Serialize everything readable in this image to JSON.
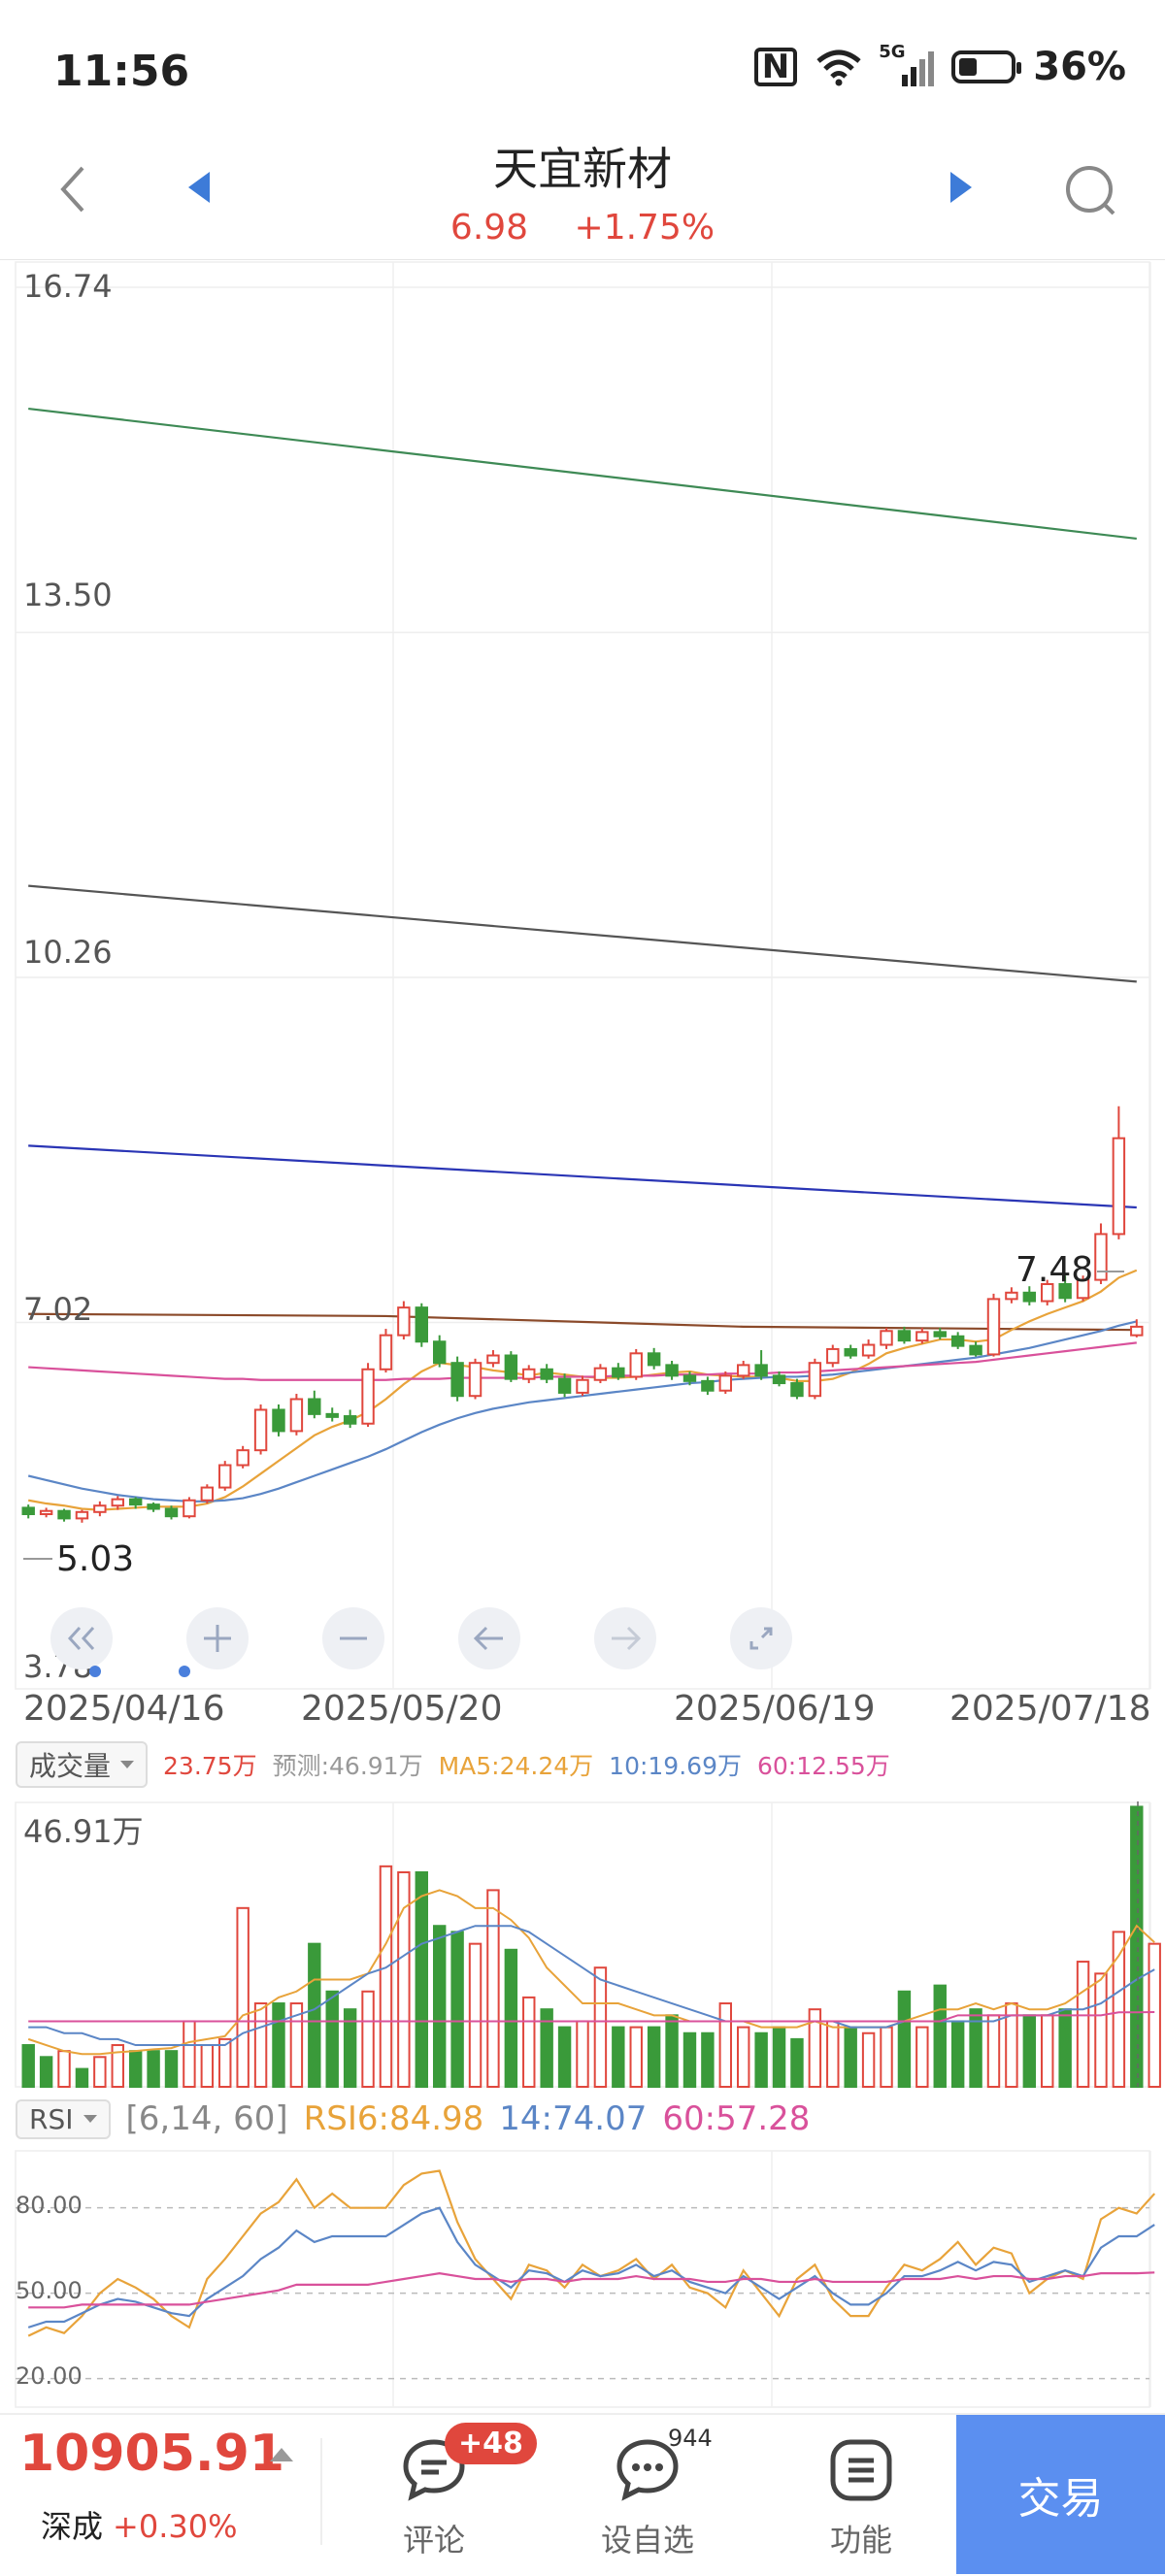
{
  "status_bar": {
    "time": "11:56",
    "network": "5G",
    "battery": "36%"
  },
  "header": {
    "title": "天宜新材",
    "price": "6.98",
    "change_pct": "+1.75%"
  },
  "chart_labels": {
    "y_ticks": [
      "16.74",
      "13.50",
      "10.26",
      "7.02",
      "3.78"
    ],
    "high_label": "7.48",
    "low_label": "5.03"
  },
  "dates": [
    "2025/04/16",
    "2025/05/20",
    "2025/06/19",
    "2025/07/18"
  ],
  "volume_legend": {
    "selector": "成交量",
    "current": "23.75万",
    "forecast": "预测:46.91万",
    "ma5": "MA5:24.24万",
    "ma10": "10:19.69万",
    "ma60": "60:12.55万",
    "max": "46.91万"
  },
  "rsi_legend": {
    "selector": "RSI",
    "params": "[6,14, 60]",
    "rsi6": "RSI6:84.98",
    "rsi14": "14:74.07",
    "rsi60": "60:57.28",
    "levels": [
      "80.00",
      "50.00",
      "20.00"
    ]
  },
  "bottom_bar": {
    "index_value": "10905.91",
    "index_name": "深成",
    "index_change": "+0.30%",
    "comment_label": "评论",
    "comment_badge": "+48",
    "fav_label": "设自选",
    "fav_count": "944",
    "func_label": "功能",
    "trade_label": "交易"
  },
  "colors": {
    "up": "#e0473d",
    "down": "#3a9a3a",
    "ma_orange": "#e8a33a",
    "ma_blue": "#5b86c6",
    "ma_pink": "#d9519b",
    "accent": "#5b8ff0"
  },
  "chart_data": {
    "type": "candlestick",
    "y_range": [
      3.78,
      16.74
    ],
    "dates": [
      "2025/04/16",
      "2025/05/20",
      "2025/06/19",
      "2025/07/18"
    ],
    "candles": [
      [
        5.28,
        5.22,
        5.31,
        5.18
      ],
      [
        5.22,
        5.25,
        5.28,
        5.19
      ],
      [
        5.25,
        5.18,
        5.27,
        5.15
      ],
      [
        5.18,
        5.24,
        5.26,
        5.14
      ],
      [
        5.24,
        5.3,
        5.34,
        5.2
      ],
      [
        5.3,
        5.36,
        5.39,
        5.26
      ],
      [
        5.36,
        5.31,
        5.38,
        5.27
      ],
      [
        5.31,
        5.27,
        5.33,
        5.24
      ],
      [
        5.27,
        5.2,
        5.3,
        5.17
      ],
      [
        5.2,
        5.35,
        5.38,
        5.18
      ],
      [
        5.35,
        5.47,
        5.5,
        5.32
      ],
      [
        5.47,
        5.68,
        5.72,
        5.44
      ],
      [
        5.68,
        5.82,
        5.86,
        5.65
      ],
      [
        5.82,
        6.2,
        6.25,
        5.78
      ],
      [
        6.2,
        6.0,
        6.25,
        5.95
      ],
      [
        6.0,
        6.3,
        6.35,
        5.96
      ],
      [
        6.3,
        6.16,
        6.38,
        6.12
      ],
      [
        6.16,
        6.14,
        6.22,
        6.09
      ],
      [
        6.14,
        6.07,
        6.2,
        6.03
      ],
      [
        6.07,
        6.58,
        6.64,
        6.04
      ],
      [
        6.58,
        6.9,
        6.96,
        6.55
      ],
      [
        6.9,
        7.16,
        7.22,
        6.86
      ],
      [
        7.16,
        6.84,
        7.2,
        6.79
      ],
      [
        6.84,
        6.64,
        6.9,
        6.6
      ],
      [
        6.64,
        6.33,
        6.7,
        6.28
      ],
      [
        6.33,
        6.64,
        6.68,
        6.3
      ],
      [
        6.64,
        6.71,
        6.76,
        6.6
      ],
      [
        6.71,
        6.49,
        6.75,
        6.46
      ],
      [
        6.49,
        6.58,
        6.62,
        6.45
      ],
      [
        6.58,
        6.49,
        6.63,
        6.45
      ],
      [
        6.49,
        6.36,
        6.54,
        6.32
      ],
      [
        6.36,
        6.48,
        6.52,
        6.33
      ],
      [
        6.48,
        6.59,
        6.63,
        6.45
      ],
      [
        6.59,
        6.51,
        6.64,
        6.48
      ],
      [
        6.51,
        6.73,
        6.77,
        6.48
      ],
      [
        6.73,
        6.62,
        6.78,
        6.58
      ],
      [
        6.62,
        6.52,
        6.66,
        6.48
      ],
      [
        6.52,
        6.47,
        6.56,
        6.43
      ],
      [
        6.47,
        6.38,
        6.51,
        6.34
      ],
      [
        6.38,
        6.52,
        6.56,
        6.35
      ],
      [
        6.52,
        6.62,
        6.66,
        6.49
      ],
      [
        6.62,
        6.52,
        6.76,
        6.48
      ],
      [
        6.52,
        6.45,
        6.56,
        6.42
      ],
      [
        6.45,
        6.33,
        6.49,
        6.3
      ],
      [
        6.33,
        6.64,
        6.68,
        6.3
      ],
      [
        6.64,
        6.77,
        6.81,
        6.6
      ],
      [
        6.77,
        6.71,
        6.81,
        6.68
      ],
      [
        6.71,
        6.81,
        6.86,
        6.68
      ],
      [
        6.81,
        6.94,
        6.97,
        6.77
      ],
      [
        6.94,
        6.85,
        6.98,
        6.82
      ],
      [
        6.85,
        6.93,
        6.97,
        6.82
      ],
      [
        6.93,
        6.89,
        6.97,
        6.86
      ],
      [
        6.89,
        6.8,
        6.93,
        6.77
      ],
      [
        6.8,
        6.72,
        6.84,
        6.7
      ],
      [
        6.72,
        7.24,
        7.29,
        6.7
      ],
      [
        7.24,
        7.3,
        7.35,
        7.2
      ],
      [
        7.3,
        7.22,
        7.36,
        7.18
      ],
      [
        7.22,
        7.38,
        7.42,
        7.18
      ],
      [
        7.38,
        7.25,
        7.46,
        7.21
      ],
      [
        7.25,
        7.42,
        7.46,
        7.22
      ],
      [
        7.42,
        7.85,
        7.95,
        7.38
      ],
      [
        7.85,
        8.75,
        9.05,
        7.8
      ],
      [
        6.9,
        6.98,
        7.05,
        6.88
      ]
    ],
    "trendlines": [
      {
        "color": "#3e8a55",
        "points": [
          [
            0,
            15.6
          ],
          [
            62,
            14.38
          ]
        ]
      },
      {
        "color": "#555555",
        "points": [
          [
            0,
            11.12
          ],
          [
            62,
            10.22
          ]
        ]
      },
      {
        "color": "#2a35b5",
        "points": [
          [
            0,
            8.68
          ],
          [
            62,
            8.1
          ]
        ]
      },
      {
        "color": "#8b4a2a",
        "points": [
          [
            0,
            7.1
          ],
          [
            20,
            7.08
          ],
          [
            40,
            6.98
          ],
          [
            62,
            6.95
          ]
        ]
      }
    ],
    "ma_lines": {
      "orange": [
        5.35,
        5.32,
        5.3,
        5.27,
        5.26,
        5.27,
        5.28,
        5.29,
        5.29,
        5.29,
        5.32,
        5.38,
        5.48,
        5.6,
        5.72,
        5.84,
        5.96,
        6.04,
        6.1,
        6.18,
        6.3,
        6.44,
        6.56,
        6.64,
        6.62,
        6.6,
        6.57,
        6.55,
        6.52,
        6.55,
        6.53,
        6.51,
        6.5,
        6.5,
        6.51,
        6.53,
        6.55,
        6.56,
        6.53,
        6.52,
        6.51,
        6.51,
        6.5,
        6.47,
        6.47,
        6.49,
        6.55,
        6.63,
        6.73,
        6.78,
        6.82,
        6.86,
        6.86,
        6.84,
        6.86,
        6.95,
        7.03,
        7.1,
        7.16,
        7.22,
        7.31,
        7.44,
        7.51
      ],
      "blue": [
        5.58,
        5.54,
        5.5,
        5.46,
        5.43,
        5.4,
        5.38,
        5.36,
        5.35,
        5.34,
        5.34,
        5.35,
        5.37,
        5.41,
        5.46,
        5.52,
        5.58,
        5.64,
        5.7,
        5.76,
        5.83,
        5.91,
        5.99,
        6.06,
        6.12,
        6.17,
        6.21,
        6.24,
        6.27,
        6.29,
        6.31,
        6.33,
        6.35,
        6.37,
        6.39,
        6.41,
        6.43,
        6.45,
        6.46,
        6.48,
        6.49,
        6.5,
        6.51,
        6.51,
        6.52,
        6.53,
        6.55,
        6.57,
        6.59,
        6.61,
        6.63,
        6.65,
        6.67,
        6.69,
        6.72,
        6.75,
        6.78,
        6.82,
        6.86,
        6.9,
        6.94,
        6.99,
        7.03
      ],
      "pink": [
        6.6,
        6.59,
        6.58,
        6.57,
        6.56,
        6.55,
        6.54,
        6.53,
        6.52,
        6.51,
        6.5,
        6.49,
        6.49,
        6.48,
        6.48,
        6.48,
        6.48,
        6.48,
        6.48,
        6.48,
        6.48,
        6.49,
        6.49,
        6.49,
        6.5,
        6.5,
        6.5,
        6.5,
        6.5,
        6.51,
        6.51,
        6.51,
        6.51,
        6.52,
        6.52,
        6.52,
        6.53,
        6.53,
        6.53,
        6.54,
        6.54,
        6.54,
        6.55,
        6.55,
        6.56,
        6.57,
        6.58,
        6.59,
        6.6,
        6.61,
        6.62,
        6.63,
        6.64,
        6.65,
        6.67,
        6.69,
        6.71,
        6.73,
        6.75,
        6.77,
        6.79,
        6.81,
        6.83
      ]
    },
    "volume_max": 46.91,
    "volume": [
      7,
      5,
      6,
      3,
      5,
      7,
      6,
      6,
      6,
      11,
      7,
      8,
      30,
      14,
      14,
      14,
      24,
      16,
      13,
      16,
      37,
      36,
      36,
      27,
      26,
      24,
      33,
      23,
      15,
      13,
      10,
      11,
      20,
      10,
      10,
      10,
      12,
      9,
      9,
      14,
      10,
      9,
      10,
      8,
      13,
      11,
      10,
      9,
      10,
      16,
      10,
      17,
      11,
      13,
      12,
      14,
      12,
      12,
      13,
      21,
      19,
      26,
      47,
      24
    ],
    "volume_up": [
      false,
      false,
      true,
      false,
      true,
      true,
      false,
      false,
      false,
      true,
      true,
      true,
      true,
      true,
      false,
      true,
      false,
      false,
      false,
      true,
      true,
      true,
      false,
      false,
      false,
      true,
      true,
      false,
      true,
      false,
      false,
      true,
      true,
      false,
      true,
      false,
      false,
      false,
      false,
      true,
      true,
      false,
      false,
      false,
      true,
      true,
      false,
      true,
      true,
      false,
      true,
      false,
      false,
      false,
      true,
      true,
      false,
      true,
      false,
      true,
      true,
      true,
      false,
      true
    ],
    "volume_ma": {
      "orange": [
        8,
        7,
        6,
        5.5,
        5.5,
        5.8,
        6,
        6.3,
        6.5,
        7.5,
        8,
        8.5,
        12,
        13,
        15,
        16,
        18,
        18,
        18,
        19,
        24,
        30,
        32,
        33,
        32,
        30,
        30,
        28,
        25,
        20,
        17,
        14,
        14,
        14,
        13,
        12,
        12,
        11,
        11,
        11,
        11,
        10,
        10,
        10,
        11,
        10,
        10,
        10,
        10,
        11,
        12,
        13,
        13,
        14,
        13,
        14,
        13,
        13,
        14,
        16,
        18,
        22,
        27,
        24.24
      ],
      "blue": [
        10,
        10,
        9,
        9,
        8,
        8,
        7,
        7,
        7,
        7,
        7,
        7,
        9,
        10,
        11,
        12,
        13,
        15,
        17,
        19,
        20,
        22,
        24,
        25,
        26,
        27,
        27,
        27,
        26,
        24,
        22,
        20,
        18,
        17,
        16,
        15,
        14,
        13,
        12,
        11,
        11,
        11,
        11,
        11,
        11,
        11,
        10,
        10,
        10,
        11,
        11,
        11,
        11,
        11,
        11,
        12,
        12,
        12,
        13,
        13,
        14,
        16,
        18,
        19.69
      ],
      "pink": [
        11,
        11,
        11,
        11,
        11,
        11,
        11,
        11,
        11,
        11,
        11,
        11,
        11,
        11,
        11,
        11,
        11,
        11,
        11,
        11,
        11,
        11,
        11,
        11,
        11,
        11,
        11,
        11,
        11,
        11,
        11,
        11,
        11,
        11,
        11,
        11,
        11,
        11,
        11,
        11,
        11,
        11,
        11,
        11,
        11,
        11,
        11,
        11,
        11,
        11,
        11,
        11,
        12,
        12,
        12,
        12,
        12,
        12,
        12,
        12,
        12,
        12.5,
        12.5,
        12.55
      ]
    },
    "rsi_range": [
      10,
      100
    ],
    "rsi": {
      "rsi6": [
        35,
        38,
        36,
        42,
        50,
        55,
        52,
        48,
        42,
        38,
        55,
        62,
        70,
        78,
        82,
        90,
        80,
        85,
        80,
        80,
        80,
        88,
        92,
        93,
        75,
        62,
        55,
        48,
        60,
        58,
        52,
        60,
        56,
        58,
        62,
        55,
        60,
        52,
        50,
        45,
        58,
        50,
        42,
        55,
        60,
        48,
        42,
        42,
        52,
        60,
        58,
        62,
        68,
        60,
        66,
        64,
        50,
        55,
        58,
        55,
        76,
        80,
        78,
        84.98
      ],
      "rsi14": [
        38,
        40,
        40,
        43,
        46,
        48,
        47,
        45,
        43,
        42,
        48,
        52,
        56,
        62,
        66,
        72,
        68,
        70,
        70,
        70,
        70,
        74,
        78,
        80,
        68,
        60,
        56,
        52,
        58,
        57,
        54,
        58,
        56,
        57,
        60,
        56,
        58,
        54,
        52,
        50,
        56,
        52,
        48,
        52,
        56,
        50,
        46,
        46,
        50,
        56,
        56,
        58,
        61,
        58,
        61,
        60,
        54,
        56,
        58,
        56,
        66,
        70,
        70,
        74.07
      ],
      "rsi60": [
        45,
        45,
        45,
        46,
        46,
        46,
        46,
        46,
        46,
        46,
        47,
        48,
        49,
        50,
        51,
        53,
        53,
        53,
        53,
        53,
        54,
        55,
        56,
        57,
        56,
        55,
        55,
        54,
        55,
        55,
        54,
        55,
        55,
        55,
        56,
        55,
        55,
        55,
        54,
        54,
        55,
        55,
        54,
        54,
        55,
        54,
        54,
        54,
        54,
        55,
        55,
        55,
        56,
        55,
        56,
        56,
        55,
        55,
        56,
        56,
        57,
        57,
        57,
        57.28
      ]
    }
  }
}
